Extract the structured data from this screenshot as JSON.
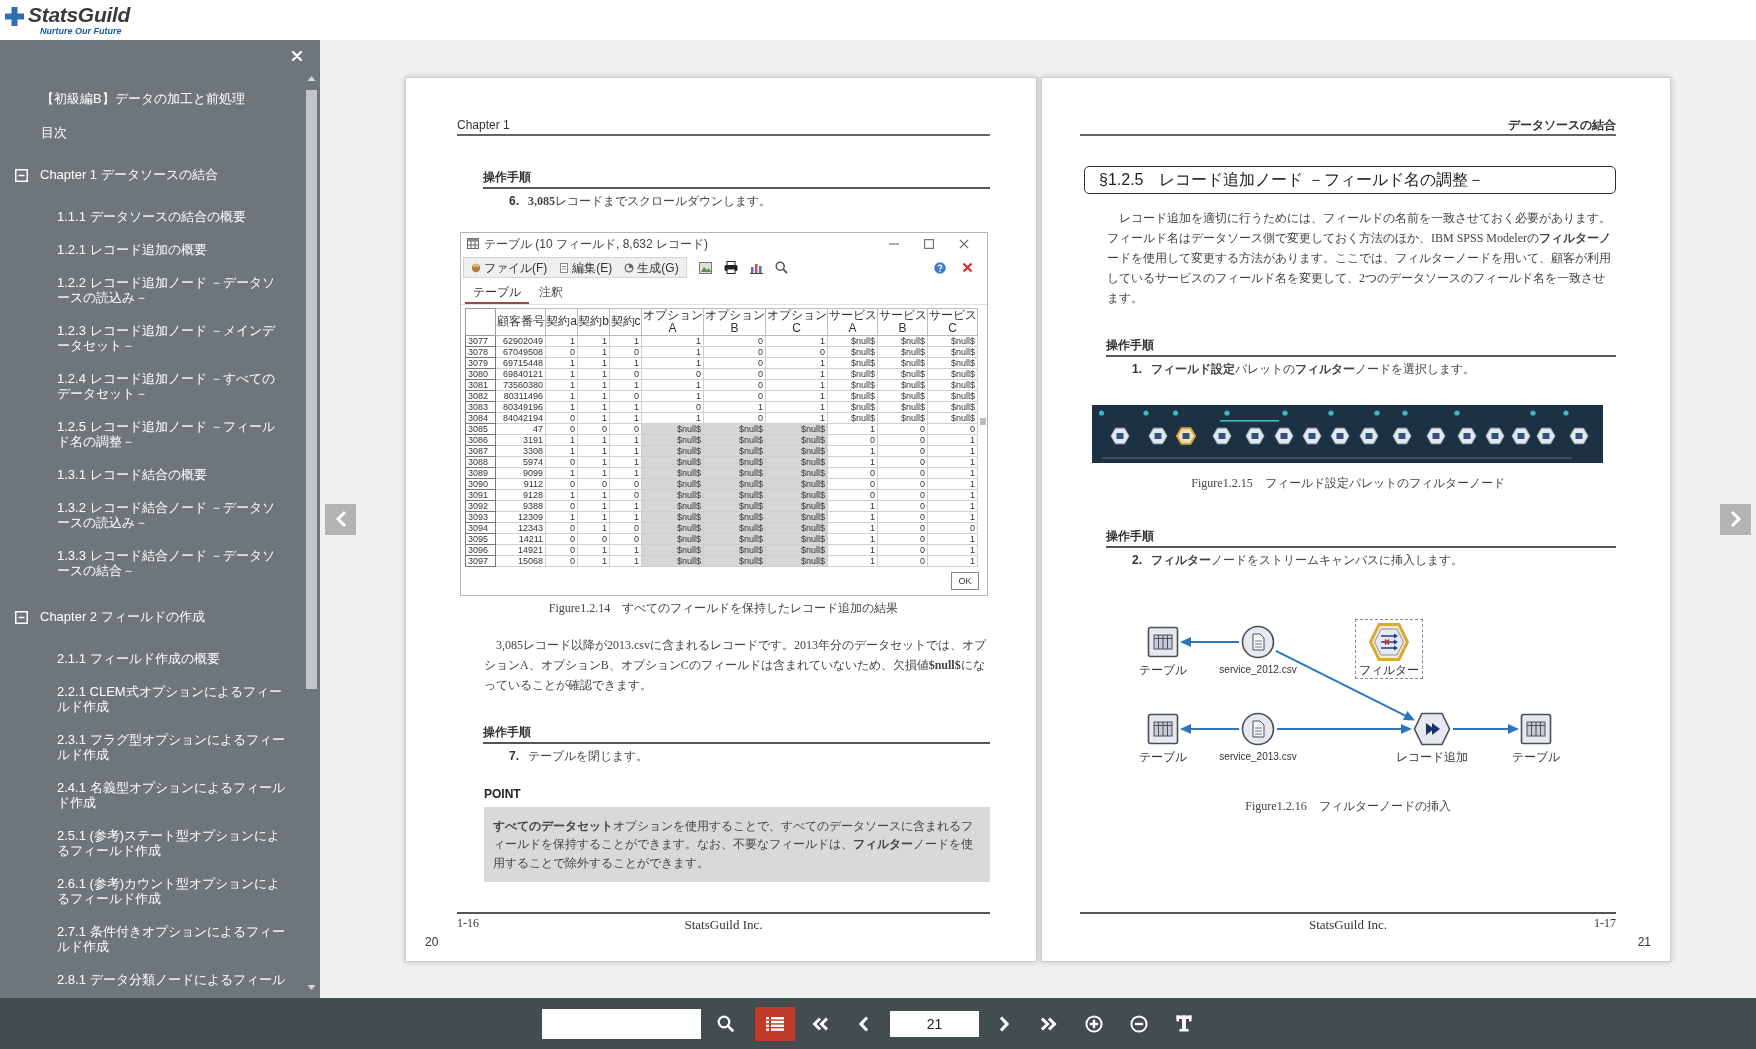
{
  "header": {
    "logo": "StatsGuild",
    "tagline": "Nurture Our Future"
  },
  "sidebar": {
    "items": [
      {
        "kind": "entry",
        "label": "【初級編B】データの加工と前処理"
      },
      {
        "kind": "entry",
        "label": "目次"
      },
      {
        "kind": "chapter",
        "label": "Chapter 1 データソースの結合",
        "expanded": true,
        "children": [
          {
            "label": "1.1.1 データソースの結合の概要"
          },
          {
            "label": "1.2.1 レコード追加の概要"
          },
          {
            "label": "1.2.2 レコード追加ノード －データソースの読込み－"
          },
          {
            "label": "1.2.3 レコード追加ノード －メインデータセット－"
          },
          {
            "label": "1.2.4 レコード追加ノード －すべてのデータセット－"
          },
          {
            "label": "1.2.5 レコード追加ノード －フィールド名の調整－"
          },
          {
            "label": "1.3.1 レコード結合の概要"
          },
          {
            "label": "1.3.2 レコード結合ノード －データソースの読込み－"
          },
          {
            "label": "1.3.3 レコード結合ノード －データソースの結合－"
          }
        ]
      },
      {
        "kind": "chapter",
        "label": "Chapter 2 フィールドの作成",
        "expanded": true,
        "children": [
          {
            "label": "2.1.1 フィールド作成の概要"
          },
          {
            "label": "2.2.1 CLEM式オプションによるフィールド作成"
          },
          {
            "label": "2.3.1 フラグ型オプションによるフィールド作成"
          },
          {
            "label": "2.4.1 名義型オプションによるフィールド作成"
          },
          {
            "label": "2.5.1 (参考)ステート型オプションによるフィールド作成"
          },
          {
            "label": "2.6.1 (参考)カウント型オプションによるフィールド作成"
          },
          {
            "label": "2.7.1 条件付きオプションによるフィールド作成"
          },
          {
            "label": "2.8.1 データ分類ノードによるフィール"
          }
        ]
      }
    ]
  },
  "pages": [
    {
      "header": "Chapter 1",
      "blocks": [
        {
          "kind": "heading",
          "text": "操作手順"
        },
        {
          "kind": "step",
          "number": "6.",
          "text": "**3,085**レコードまでスクロールダウンします。"
        },
        {
          "kind": "table_window",
          "title": "テーブル (10 フィールド, 8,632 レコード)",
          "menus": [
            "ファイル(F)",
            "編集(E)",
            "生成(G)"
          ],
          "tabs": [
            {
              "label": "テーブル",
              "selected": true
            },
            {
              "label": "注釈",
              "selected": false
            }
          ],
          "columns": [
            {
              "label": "顧客番号",
              "selected": false
            },
            {
              "label": "契約a",
              "selected": false
            },
            {
              "label": "契約b",
              "selected": false
            },
            {
              "label": "契約c",
              "selected": false
            },
            {
              "label": "オプションA",
              "selected": true
            },
            {
              "label": "オプションB",
              "selected": true
            },
            {
              "label": "オプションC",
              "selected": true
            },
            {
              "label": "サービスA",
              "selected": false
            },
            {
              "label": "サービスB",
              "selected": false
            },
            {
              "label": "サービスC",
              "selected": false
            }
          ],
          "rows": [
            {
              "row": "3077",
              "cells": [
                "62902049",
                "1",
                "1",
                "1",
                "1",
                "0",
                "1",
                "$null$",
                "$null$",
                "$null$"
              ],
              "selected": false
            },
            {
              "row": "3078",
              "cells": [
                "67049508",
                "0",
                "1",
                "0",
                "1",
                "0",
                "0",
                "$null$",
                "$null$",
                "$null$"
              ],
              "selected": false
            },
            {
              "row": "3079",
              "cells": [
                "69715448",
                "1",
                "1",
                "1",
                "1",
                "0",
                "1",
                "$null$",
                "$null$",
                "$null$"
              ],
              "selected": false
            },
            {
              "row": "3080",
              "cells": [
                "69840121",
                "1",
                "1",
                "0",
                "0",
                "0",
                "1",
                "$null$",
                "$null$",
                "$null$"
              ],
              "selected": false
            },
            {
              "row": "3081",
              "cells": [
                "73560380",
                "1",
                "1",
                "1",
                "1",
                "0",
                "1",
                "$null$",
                "$null$",
                "$null$"
              ],
              "selected": false
            },
            {
              "row": "3082",
              "cells": [
                "80311496",
                "1",
                "1",
                "0",
                "1",
                "0",
                "1",
                "$null$",
                "$null$",
                "$null$"
              ],
              "selected": false
            },
            {
              "row": "3083",
              "cells": [
                "80349196",
                "1",
                "1",
                "1",
                "0",
                "1",
                "1",
                "$null$",
                "$null$",
                "$null$"
              ],
              "selected": false
            },
            {
              "row": "3084",
              "cells": [
                "84042194",
                "0",
                "1",
                "1",
                "1",
                "0",
                "1",
                "$null$",
                "$null$",
                "$null$"
              ],
              "selected": false
            },
            {
              "row": "3085",
              "cells": [
                "47",
                "0",
                "0",
                "0",
                "$null$",
                "$null$",
                "$null$",
                "1",
                "0",
                "0"
              ],
              "selected": true
            },
            {
              "row": "3086",
              "cells": [
                "3191",
                "1",
                "1",
                "1",
                "$null$",
                "$null$",
                "$null$",
                "0",
                "0",
                "1"
              ],
              "selected": true
            },
            {
              "row": "3087",
              "cells": [
                "3308",
                "1",
                "1",
                "1",
                "$null$",
                "$null$",
                "$null$",
                "1",
                "0",
                "1"
              ],
              "selected": true
            },
            {
              "row": "3088",
              "cells": [
                "5974",
                "0",
                "1",
                "1",
                "$null$",
                "$null$",
                "$null$",
                "1",
                "0",
                "1"
              ],
              "selected": true
            },
            {
              "row": "3089",
              "cells": [
                "9099",
                "1",
                "1",
                "1",
                "$null$",
                "$null$",
                "$null$",
                "0",
                "0",
                "1"
              ],
              "selected": true
            },
            {
              "row": "3090",
              "cells": [
                "9112",
                "0",
                "0",
                "0",
                "$null$",
                "$null$",
                "$null$",
                "0",
                "0",
                "1"
              ],
              "selected": true
            },
            {
              "row": "3091",
              "cells": [
                "9128",
                "1",
                "1",
                "0",
                "$null$",
                "$null$",
                "$null$",
                "0",
                "0",
                "1"
              ],
              "selected": true
            },
            {
              "row": "3092",
              "cells": [
                "9388",
                "0",
                "1",
                "1",
                "$null$",
                "$null$",
                "$null$",
                "1",
                "0",
                "1"
              ],
              "selected": true
            },
            {
              "row": "3093",
              "cells": [
                "12309",
                "1",
                "1",
                "1",
                "$null$",
                "$null$",
                "$null$",
                "1",
                "0",
                "1"
              ],
              "selected": true
            },
            {
              "row": "3094",
              "cells": [
                "12343",
                "0",
                "1",
                "0",
                "$null$",
                "$null$",
                "$null$",
                "1",
                "0",
                "0"
              ],
              "selected": true
            },
            {
              "row": "3095",
              "cells": [
                "14211",
                "0",
                "0",
                "0",
                "$null$",
                "$null$",
                "$null$",
                "1",
                "0",
                "1"
              ],
              "selected": true
            },
            {
              "row": "3096",
              "cells": [
                "14921",
                "0",
                "1",
                "1",
                "$null$",
                "$null$",
                "$null$",
                "1",
                "0",
                "1"
              ],
              "selected": true
            },
            {
              "row": "3097",
              "cells": [
                "15068",
                "0",
                "1",
                "1",
                "$null$",
                "$null$",
                "$null$",
                "1",
                "0",
                "1"
              ],
              "selected": true
            }
          ],
          "button": "OK"
        },
        {
          "kind": "caption",
          "text": "Figure1.2.14　すべてのフィールドを保持したレコード追加の結果"
        },
        {
          "kind": "paragraph",
          "text": "3,085レコード以降が2013.csvに含まれるレコードです。2013年分のデータセットでは、オプションA、オプションB、オプションCのフィールドは含まれていないため、欠損値**$null$**になっていることが確認できます。"
        },
        {
          "kind": "heading",
          "text": "操作手順"
        },
        {
          "kind": "step",
          "number": "7.",
          "text": "テーブルを閉じます。"
        },
        {
          "kind": "point",
          "label": "POINT",
          "text": "**すべてのデータセット**オプションを使用することで、すべてのデータソースに含まれるフィールドを保持することができます。なお、不要なフィールドは、**フィルター**ノードを使用することで除外することができます。"
        }
      ],
      "footer": {
        "folio": "1-16",
        "company": "StatsGuild Inc."
      },
      "page_number": "20"
    },
    {
      "header": "データソースの結合",
      "blocks": [
        {
          "kind": "section_title",
          "text": "§1.2.5　レコード追加ノード －フィールド名の調整－"
        },
        {
          "kind": "paragraph",
          "text": "レコード追加を適切に行うためには、フィールドの名前を一致させておく必要があります。フィールド名はデータソース側で変更しておく方法のほか、IBM SPSS Modelerの**フィルターノ**ードを使用して変更する方法があります。ここでは、フィルターノードを用いて、顧客が利用しているサービスのフィールド名を変更して、2つのデータソースのフィールド名を一致させます。"
        },
        {
          "kind": "heading",
          "text": "操作手順"
        },
        {
          "kind": "step",
          "number": "1.",
          "text": "**フィールド設定**パレットの**フィルター**ノードを選択します。"
        },
        {
          "kind": "palette"
        },
        {
          "kind": "caption",
          "text": "Figure1.2.15　フィールド設定パレットのフィルターノード"
        },
        {
          "kind": "heading",
          "text": "操作手順"
        },
        {
          "kind": "step",
          "number": "2.",
          "text": "**フィルター**ノードをストリームキャンバスに挿入します。"
        },
        {
          "kind": "stream",
          "nodes": [
            {
              "kind": "table",
              "label": "テーブル",
              "selected": false
            },
            {
              "kind": "source",
              "label": "service_2012.csv",
              "selected": false
            },
            {
              "kind": "filter",
              "label": "フィルター",
              "selected": true
            },
            {
              "kind": "table",
              "label": "テーブル",
              "selected": false
            },
            {
              "kind": "source",
              "label": "service_2013.csv",
              "selected": false
            },
            {
              "kind": "append",
              "label": "レコード追加",
              "selected": false
            },
            {
              "kind": "table",
              "label": "テーブル",
              "selected": false
            }
          ]
        },
        {
          "kind": "caption",
          "text": "Figure1.2.16　フィルターノードの挿入"
        }
      ],
      "footer": {
        "folio": "1-17",
        "company": "StatsGuild Inc."
      },
      "page_number": "21"
    }
  ],
  "toolbar": {
    "toc_selected": true,
    "page": "21"
  }
}
